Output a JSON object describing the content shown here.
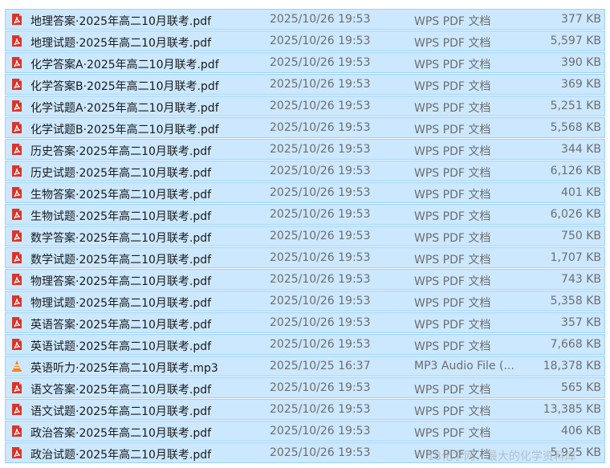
{
  "files": [
    {
      "name": "地理答案·2025年高二10月联考.pdf",
      "modified": "2025/10/26 19:53",
      "type": "WPS PDF 文档",
      "size": "377 KB",
      "icon": "pdf-file-icon"
    },
    {
      "name": "地理试题·2025年高二10月联考.pdf",
      "modified": "2025/10/26 19:53",
      "type": "WPS PDF 文档",
      "size": "5,597 KB",
      "icon": "pdf-file-icon"
    },
    {
      "name": "化学答案A·2025年高二10月联考.pdf",
      "modified": "2025/10/26 19:53",
      "type": "WPS PDF 文档",
      "size": "390 KB",
      "icon": "pdf-file-icon"
    },
    {
      "name": "化学答案B·2025年高二10月联考.pdf",
      "modified": "2025/10/26 19:53",
      "type": "WPS PDF 文档",
      "size": "369 KB",
      "icon": "pdf-file-icon"
    },
    {
      "name": "化学试题A·2025年高二10月联考.pdf",
      "modified": "2025/10/26 19:53",
      "type": "WPS PDF 文档",
      "size": "5,251 KB",
      "icon": "pdf-file-icon"
    },
    {
      "name": "化学试题B·2025年高二10月联考.pdf",
      "modified": "2025/10/26 19:53",
      "type": "WPS PDF 文档",
      "size": "5,568 KB",
      "icon": "pdf-file-icon"
    },
    {
      "name": "历史答案·2025年高二10月联考.pdf",
      "modified": "2025/10/26 19:53",
      "type": "WPS PDF 文档",
      "size": "344 KB",
      "icon": "pdf-file-icon"
    },
    {
      "name": "历史试题·2025年高二10月联考.pdf",
      "modified": "2025/10/26 19:53",
      "type": "WPS PDF 文档",
      "size": "6,126 KB",
      "icon": "pdf-file-icon"
    },
    {
      "name": "生物答案·2025年高二10月联考.pdf",
      "modified": "2025/10/26 19:53",
      "type": "WPS PDF 文档",
      "size": "401 KB",
      "icon": "pdf-file-icon"
    },
    {
      "name": "生物试题·2025年高二10月联考.pdf",
      "modified": "2025/10/26 19:53",
      "type": "WPS PDF 文档",
      "size": "6,026 KB",
      "icon": "pdf-file-icon"
    },
    {
      "name": "数学答案·2025年高二10月联考.pdf",
      "modified": "2025/10/26 19:53",
      "type": "WPS PDF 文档",
      "size": "750 KB",
      "icon": "pdf-file-icon"
    },
    {
      "name": "数学试题·2025年高二10月联考.pdf",
      "modified": "2025/10/26 19:53",
      "type": "WPS PDF 文档",
      "size": "1,707 KB",
      "icon": "pdf-file-icon"
    },
    {
      "name": "物理答案·2025年高二10月联考.pdf",
      "modified": "2025/10/26 19:53",
      "type": "WPS PDF 文档",
      "size": "743 KB",
      "icon": "pdf-file-icon"
    },
    {
      "name": "物理试题·2025年高二10月联考.pdf",
      "modified": "2025/10/26 19:53",
      "type": "WPS PDF 文档",
      "size": "5,358 KB",
      "icon": "pdf-file-icon"
    },
    {
      "name": "英语答案·2025年高二10月联考.pdf",
      "modified": "2025/10/26 19:53",
      "type": "WPS PDF 文档",
      "size": "357 KB",
      "icon": "pdf-file-icon"
    },
    {
      "name": "英语试题·2025年高二10月联考.pdf",
      "modified": "2025/10/26 19:53",
      "type": "WPS PDF 文档",
      "size": "7,668 KB",
      "icon": "pdf-file-icon"
    },
    {
      "name": "英语听力·2025年高二10月联考.mp3",
      "modified": "2025/10/25 16:37",
      "type": "MP3 Audio File (...",
      "size": "18,378 KB",
      "icon": "vlc-audio-file-icon"
    },
    {
      "name": "语文答案·2025年高二10月联考.pdf",
      "modified": "2025/10/26 19:53",
      "type": "WPS PDF 文档",
      "size": "565 KB",
      "icon": "pdf-file-icon"
    },
    {
      "name": "语文试题·2025年高二10月联考.pdf",
      "modified": "2025/10/26 19:53",
      "type": "WPS PDF 文档",
      "size": "13,385 KB",
      "icon": "pdf-file-icon"
    },
    {
      "name": "政治答案·2025年高二10月联考.pdf",
      "modified": "2025/10/26 19:53",
      "type": "WPS PDF 文档",
      "size": "406 KB",
      "icon": "pdf-file-icon"
    },
    {
      "name": "政治试题·2025年高二10月联考.pdf",
      "modified": "2025/10/26 19:53",
      "type": "WPS PDF 文档",
      "size": "5,925 KB",
      "icon": "pdf-file-icon"
    }
  ],
  "watermark": "18化学网，最大的化学资料库",
  "colors": {
    "selection_bg": "#cce8ff",
    "selection_border": "#99d1ff",
    "pdf_icon": "#d9352b",
    "vlc_icon": "#f58220"
  }
}
